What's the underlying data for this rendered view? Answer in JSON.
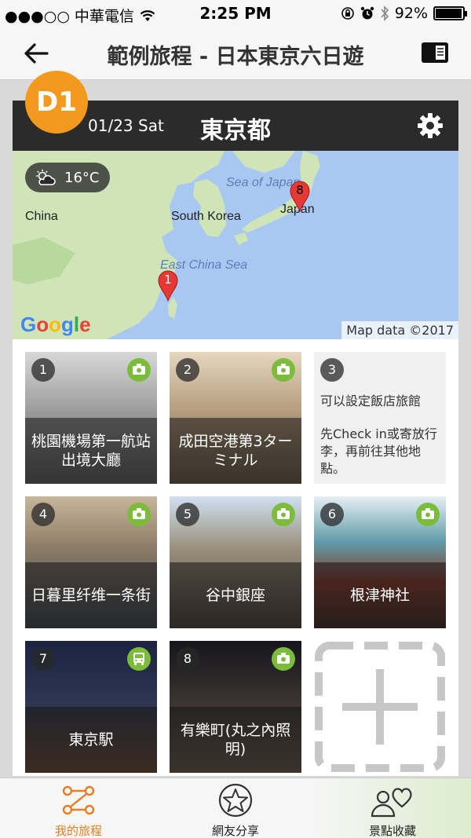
{
  "status_bar": {
    "carrier": "●●●○○ 中華電信",
    "time": "2:25 PM",
    "battery": "92%",
    "battery_level": 0.92
  },
  "nav": {
    "title": "範例旅程 - 日本東京六日遊"
  },
  "day": {
    "badge": "D1",
    "date": "01/23 Sat",
    "city": "東京都"
  },
  "map": {
    "weather": "16°C",
    "labels": {
      "china": "China",
      "south_korea": "South Korea",
      "sea_of_japan": "Sea of Japan",
      "japan": "Japan",
      "east_china_sea": "East China Sea"
    },
    "pins": [
      "1",
      "8"
    ],
    "logo": "Google",
    "attribution": "Map data ©2017"
  },
  "tiles": [
    {
      "num": "1",
      "caption": "桃園機場第一航站出境大廳",
      "badge": "camera-icon"
    },
    {
      "num": "2",
      "caption": "成田空港第3ターミナル",
      "badge": "camera-icon"
    },
    {
      "num": "3",
      "note_title": "可以設定飯店旅館",
      "note_body": "先Check in或寄放行李，再前往其他地點。"
    },
    {
      "num": "4",
      "caption": "日暮里纤维一条街",
      "badge": "camera-icon"
    },
    {
      "num": "5",
      "caption": "谷中銀座",
      "badge": "camera-icon"
    },
    {
      "num": "6",
      "caption": "根津神社",
      "badge": "camera-icon"
    },
    {
      "num": "7",
      "caption": "東京駅",
      "badge": "bus-icon"
    },
    {
      "num": "8",
      "caption": "有樂町(丸之內照明)",
      "badge": "camera-icon"
    }
  ],
  "tabbar": {
    "my_trips": "我的旅程",
    "shared": "網友分享",
    "favorites": "景點收藏"
  },
  "colors": {
    "accent": "#f39a1e",
    "active_tab": "#e67e22",
    "photo_badge": "#7bbd3a",
    "header_bg": "#2b2b2b"
  }
}
